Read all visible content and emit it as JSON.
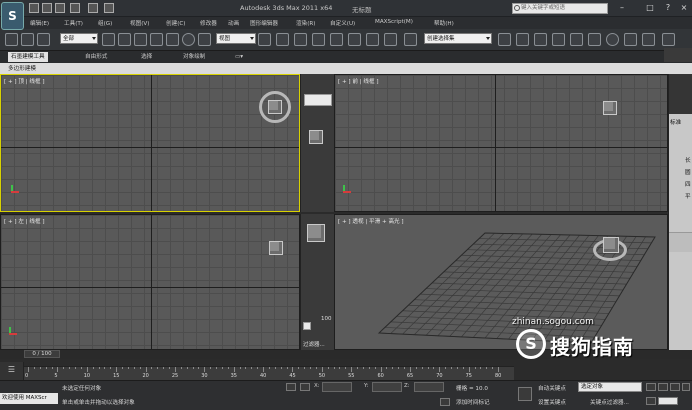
{
  "title_bar": {
    "app_title": "Autodesk 3ds Max  2011 x64",
    "document": "无标题",
    "search_placeholder": "键入关键字或短语",
    "logo": "S"
  },
  "menu": [
    "编辑(E)",
    "工具(T)",
    "组(G)",
    "视图(V)",
    "创建(C)",
    "修改器",
    "动画",
    "图形编辑器",
    "渲染(R)",
    "自定义(U)",
    "MAXScript(M)",
    "帮助(H)"
  ],
  "toolbar": {
    "selection_filter": "全部",
    "ref_coord": "视图",
    "named_selection": "创建选择集"
  },
  "ribbon": {
    "tabs": [
      "石墨建模工具",
      "自由形式",
      "选择",
      "对象绘制"
    ],
    "active_tab": 0,
    "panel_label": "多边形建模"
  },
  "viewports": [
    {
      "label": "[ + ] 顶 | 线框 ]"
    },
    {
      "label": "[ + ] 前 | 线框 ]"
    },
    {
      "label": "[ + ] 左 | 线框 ]"
    },
    {
      "label": "[ + ] 透视 | 平滑 + 高光 ]"
    }
  ],
  "side_panel": {
    "value": "100",
    "filter_label": "过滤器..."
  },
  "command_panel": {
    "items": [
      "标准",
      "长",
      "圆",
      "四",
      "平"
    ]
  },
  "timeline": {
    "frame": "0 / 100",
    "ticks": [
      "0",
      "5",
      "10",
      "15",
      "20",
      "25",
      "30",
      "35",
      "40",
      "45",
      "50",
      "55",
      "60",
      "65",
      "70",
      "75",
      "80"
    ]
  },
  "status": {
    "maxscript_label": "欢迎使用  MAXScr",
    "line1": "未选定任何对象",
    "line2": "单击或单击并拖动以选择对象",
    "x_label": "X:",
    "y_label": "Y:",
    "z_label": "Z:",
    "grid": "栅格 = 10.0",
    "add_tag": "添加时间标记",
    "auto_key": "自动关键点",
    "set_key": "设置关键点",
    "selected_dd": "选定对象",
    "key_filter": "关键点过滤器..."
  },
  "watermark": {
    "url": "zhinan.sogou.com",
    "text": "搜狗指南",
    "logo": "S"
  },
  "colors": {
    "viewport_bg": "#595959",
    "active_border": "#d8d200",
    "ribbon_active": "#e2e2e2"
  }
}
